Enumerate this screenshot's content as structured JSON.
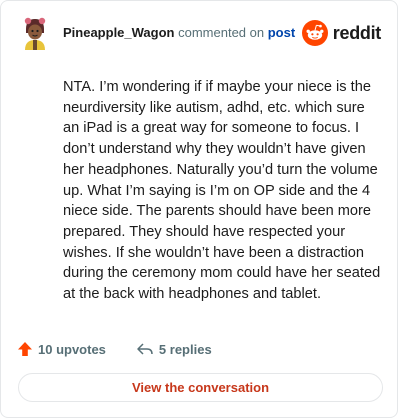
{
  "comment": {
    "username": "Pineapple_Wagon",
    "action_text": "commented on",
    "target_link": "post",
    "body": "NTA. I’m wondering if if maybe your niece is the neurdiversity like autism, adhd, etc. which sure an iPad is a great way for someone to focus. I don’t understand why they wouldn’t have given her headphones. Naturally you’d turn the volume up. What I’m saying is I’m on OP side and the 4 niece side. The parents should have been more prepared. They should have respected your wishes. If she wouldn’t have been a distraction during the ceremony mom could have her seated at the back with headphones and tablet."
  },
  "brand": {
    "wordmark": "reddit",
    "icon": "reddit-snoo-icon",
    "accent": "#ff4500"
  },
  "stats": {
    "upvotes": "10 upvotes",
    "replies": "5 replies",
    "upvote_icon": "upvote-arrow-icon",
    "reply_icon": "reply-arrow-icon"
  },
  "cta": {
    "label": "View the conversation",
    "color": "#c7371a"
  }
}
